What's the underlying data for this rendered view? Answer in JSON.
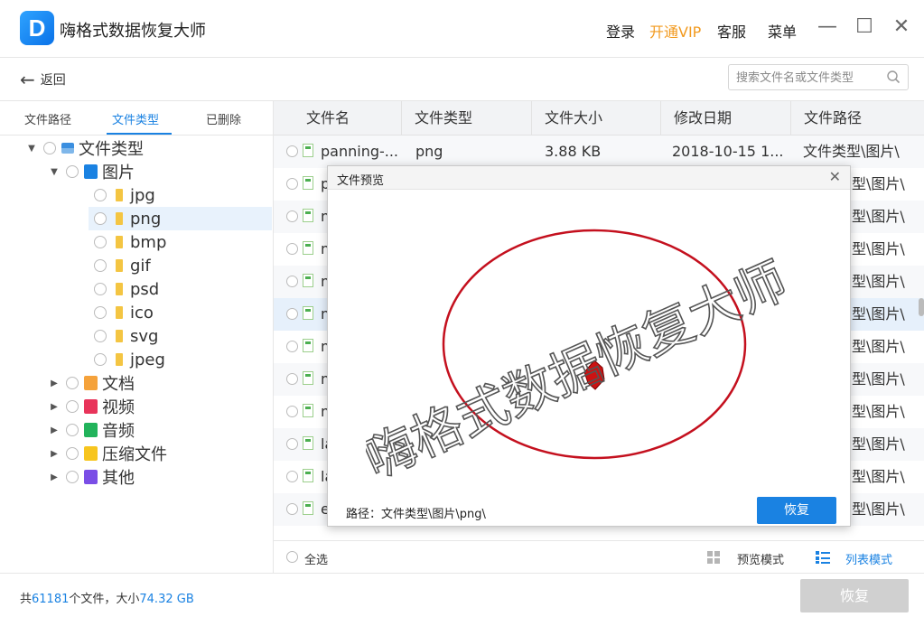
{
  "app": {
    "title": "嗨格式数据恢复大师",
    "logo_letter": "D",
    "menu": {
      "login": "登录",
      "vip": "开通VIP",
      "service": "客服",
      "menu": "菜单"
    },
    "window": {
      "minimize": "—",
      "maximize": "☐",
      "close": "✕"
    },
    "colors": {
      "accent": "#1a82e2",
      "vip": "#f29a1f"
    }
  },
  "toolbar": {
    "back_label": "返回",
    "search_placeholder": "搜索文件名或文件类型"
  },
  "left_tabs": {
    "path": "文件路径",
    "type": "文件类型",
    "deleted": "已删除"
  },
  "tree": {
    "root": "文件类型",
    "images": "图片",
    "image_children": [
      "jpg",
      "png",
      "bmp",
      "gif",
      "psd",
      "ico",
      "svg",
      "jpeg"
    ],
    "docs": "文档",
    "video": "视频",
    "audio": "音频",
    "archive": "压缩文件",
    "other": "其他"
  },
  "table": {
    "headers": [
      "文件名",
      "文件类型",
      "文件大小",
      "修改日期",
      "文件路径"
    ],
    "rows": [
      {
        "name": "panning-...",
        "type": "png",
        "size": "3.88 KB",
        "date": "2018-10-15 1...",
        "path": "文件类型\\图片\\"
      },
      {
        "name": "p",
        "path": "型\\图片\\"
      },
      {
        "name": "m",
        "path": "型\\图片\\"
      },
      {
        "name": "m",
        "path": "型\\图片\\"
      },
      {
        "name": "m",
        "path": "型\\图片\\"
      },
      {
        "name": "m",
        "path": "型\\图片\\"
      },
      {
        "name": "m",
        "path": "型\\图片\\"
      },
      {
        "name": "m",
        "path": "型\\图片\\"
      },
      {
        "name": "m",
        "path": "型\\图片\\"
      },
      {
        "name": "la",
        "path": "型\\图片\\"
      },
      {
        "name": "la",
        "path": "型\\图片\\"
      },
      {
        "name": "e",
        "path": "型\\图片\\"
      }
    ]
  },
  "footer": {
    "select_all": "全选",
    "preview_mode": "预览模式",
    "list_mode": "列表模式"
  },
  "status": {
    "prefix": "共",
    "count": "61181",
    "mid": "个文件，大小",
    "size": "74.32 GB",
    "recover": "恢复"
  },
  "dialog": {
    "title": "文件预览",
    "close": "✕",
    "path_label": "路径：",
    "path_value": "文件类型\\图片\\png\\",
    "recover": "恢复"
  },
  "watermark": "嗨格式数据恢复大师"
}
